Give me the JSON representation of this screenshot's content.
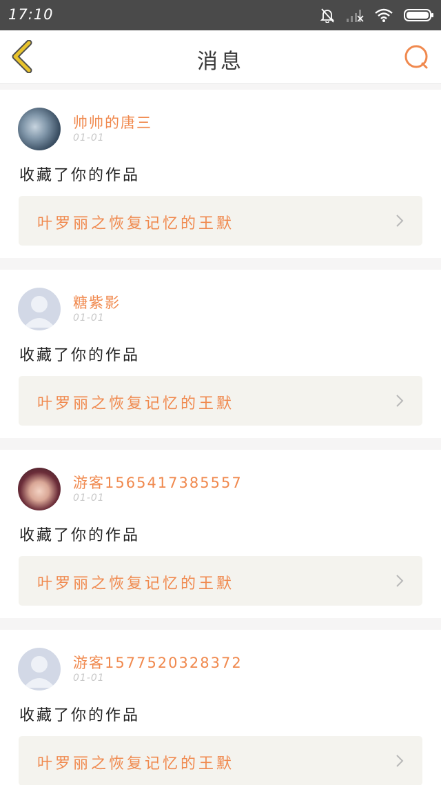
{
  "status_bar": {
    "time": "17:10",
    "icons": [
      "bell-off-icon",
      "signal-icon",
      "wifi-icon",
      "battery-icon"
    ]
  },
  "nav": {
    "title": "消息",
    "back_icon": "chevron-left-icon",
    "search_icon": "search-icon",
    "accent_color": "#f0894e",
    "back_color": "#e8c32c"
  },
  "messages": [
    {
      "username": "帅帅的唐三",
      "date": "01-01",
      "action": "收藏了你的作品",
      "work_title": "叶罗丽之恢复记忆的王默",
      "avatar": "photo"
    },
    {
      "username": "糖紫影",
      "date": "01-01",
      "action": "收藏了你的作品",
      "work_title": "叶罗丽之恢复记忆的王默",
      "avatar": "default-avatar-icon"
    },
    {
      "username": "游客1565417385557",
      "date": "01-01",
      "action": "收藏了你的作品",
      "work_title": "叶罗丽之恢复记忆的王默",
      "avatar": "photo"
    },
    {
      "username": "游客1577520328372",
      "date": "01-01",
      "action": "收藏了你的作品",
      "work_title": "叶罗丽之恢复记忆的王默",
      "avatar": "default-avatar-icon"
    }
  ]
}
